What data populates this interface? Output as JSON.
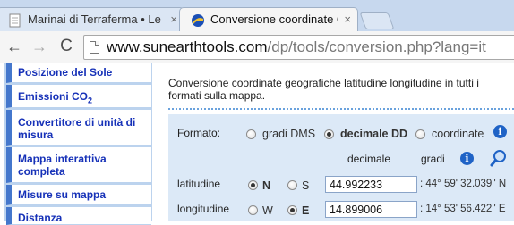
{
  "browser": {
    "tabs": [
      {
        "title": "Marinai di Terraferma • Le",
        "close": "×",
        "active": false
      },
      {
        "title": "Conversione coordinate G",
        "close": "×",
        "active": true
      }
    ],
    "nav": {
      "back": "←",
      "forward": "→",
      "reload": "C"
    },
    "url": {
      "host": "www.sunearthtools.com",
      "path": "/dp/tools/conversion.php?lang=it"
    }
  },
  "sidebar": {
    "items": [
      {
        "label": "Posizione del Sole"
      },
      {
        "label": "Emissioni CO",
        "sub": "2"
      },
      {
        "label": "Convertitore di unità di misura"
      },
      {
        "label": "Mappa interattiva completa"
      },
      {
        "label": "Misure su mappa"
      },
      {
        "label": "Distanza"
      }
    ]
  },
  "main": {
    "intro": "Conversione coordinate geografiche latitudine longitudine in tutti i formati sulla mappa.",
    "format_label": "Formato:",
    "format_options": [
      {
        "label": "gradi DMS",
        "checked": false
      },
      {
        "label": "decimale DD",
        "checked": true
      },
      {
        "label": "coordinate",
        "checked": false
      }
    ],
    "col_decimal": "decimale",
    "col_degrees": "gradi",
    "info_glyph": "i",
    "latitude": {
      "label": "latitudine",
      "dir1": "N",
      "dir1_checked": true,
      "dir2": "S",
      "dir2_checked": false,
      "value": "44.992233",
      "dms": ": 44° 59' 32.039'' N"
    },
    "longitude": {
      "label": "longitudine",
      "dir1": "W",
      "dir1_checked": false,
      "dir2": "E",
      "dir2_checked": true,
      "value": "14.899006",
      "dms": ": 14° 53' 56.422'' E"
    }
  },
  "colors": {
    "tabstrip": "#c7d8ee",
    "sidebar_link": "#1631b8",
    "sidebar_bar": "#4477cc",
    "panel": "#dce9f7"
  }
}
